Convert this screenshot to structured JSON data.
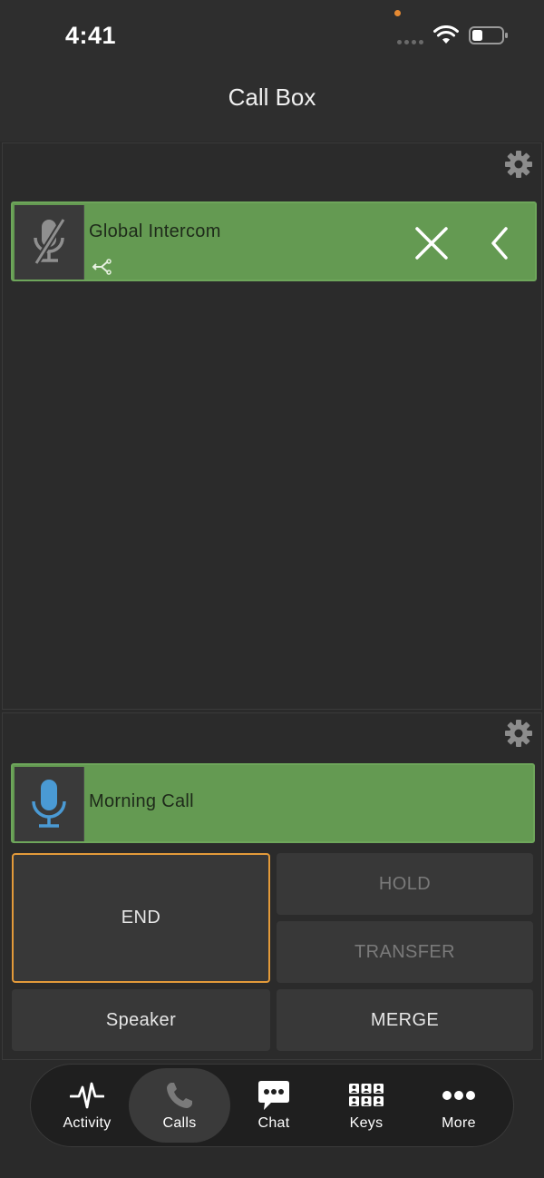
{
  "status_bar": {
    "time": "4:41"
  },
  "header": {
    "title": "Call Box"
  },
  "intercom": {
    "name": "Global Intercom"
  },
  "active_call": {
    "name": "Morning Call"
  },
  "controls": {
    "end": "END",
    "hold": "HOLD",
    "transfer": "TRANSFER",
    "speaker": "Speaker",
    "merge": "MERGE"
  },
  "tabs": [
    {
      "label": "Activity",
      "icon": "activity-icon"
    },
    {
      "label": "Calls",
      "icon": "phone-icon",
      "active": true
    },
    {
      "label": "Chat",
      "icon": "chat-icon"
    },
    {
      "label": "Keys",
      "icon": "keys-icon"
    },
    {
      "label": "More",
      "icon": "more-icon"
    }
  ],
  "colors": {
    "call_green": "#649a52",
    "mic_blue": "#4a9ad4",
    "end_border": "#e39a3a",
    "indicator_orange": "#e58a33"
  }
}
